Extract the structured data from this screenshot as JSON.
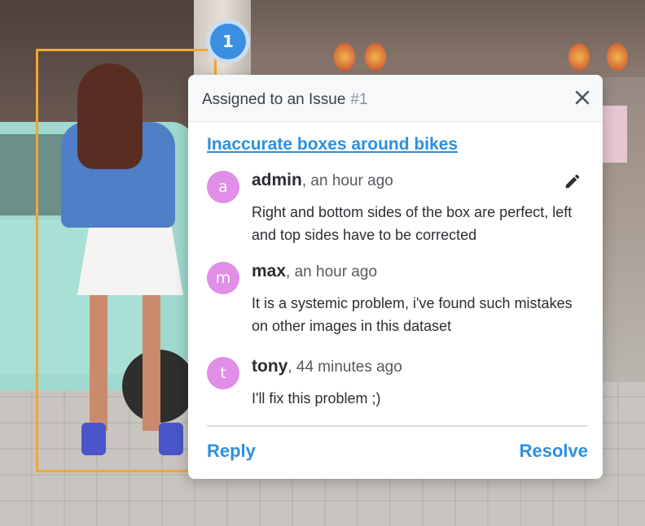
{
  "annotation": {
    "marker_number": "1",
    "box_color": "#f0a733",
    "marker_color": "#3b8fe0"
  },
  "popup": {
    "header_title": "Assigned to an Issue",
    "issue_number": "#1",
    "close_icon": "close-icon",
    "issue_title": "Inaccurate boxes around bikes",
    "link_color": "#2e8fdc",
    "comments": [
      {
        "avatar_letter": "a",
        "author": "admin",
        "time": ", an hour ago",
        "text": "Right and bottom sides of the box are perfect, left and top sides have to be corrected",
        "edit_icon": "pencil-icon"
      },
      {
        "avatar_letter": "m",
        "author": "max",
        "time": ", an hour ago",
        "text": "It is a systemic problem, i've found such mistakes on other images in this dataset"
      },
      {
        "avatar_letter": "t",
        "author": "tony",
        "time": ", 44 minutes ago",
        "text": "I'll fix this problem ;)"
      }
    ],
    "avatar_color": "#e08ee7",
    "reply_label": "Reply",
    "resolve_label": "Resolve"
  }
}
